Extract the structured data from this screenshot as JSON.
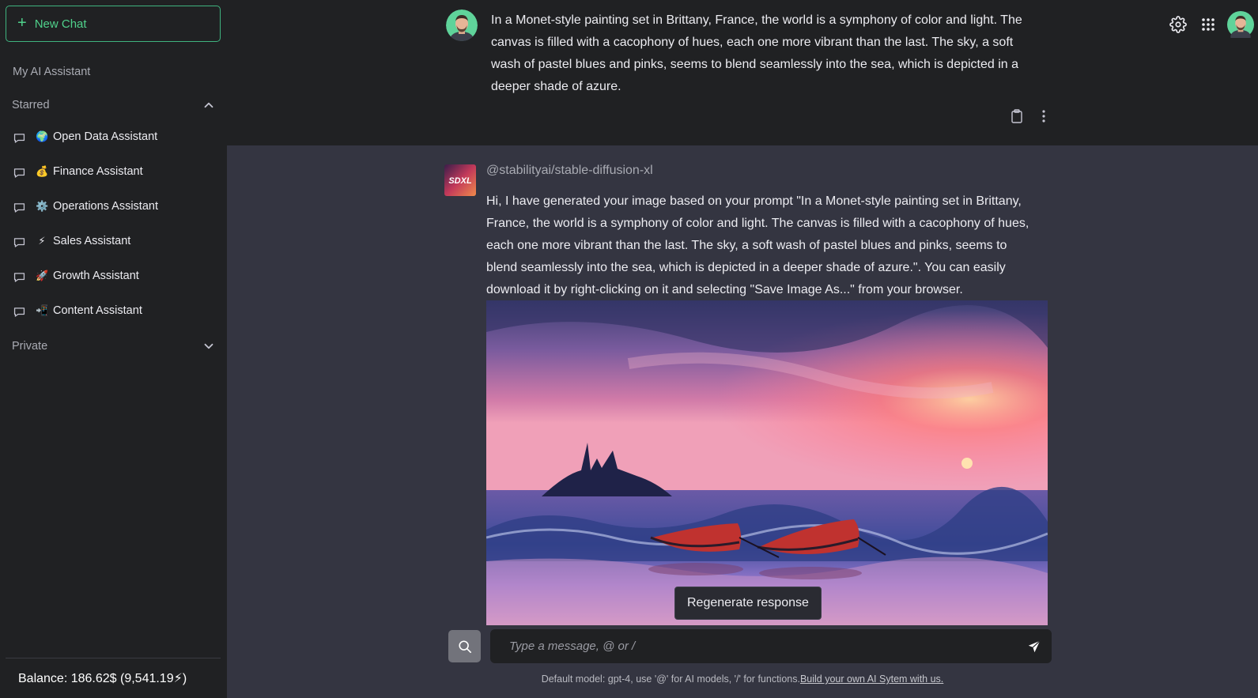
{
  "sidebar": {
    "new_chat_label": "New Chat",
    "workspace_title": "My AI Assistant",
    "starred_label": "Starred",
    "private_label": "Private",
    "items": [
      {
        "emoji": "🌍",
        "label": "Open Data Assistant"
      },
      {
        "emoji": "💰",
        "label": "Finance Assistant"
      },
      {
        "emoji": "⚙️",
        "label": "Operations Assistant"
      },
      {
        "emoji": "⚡",
        "label": "Sales Assistant"
      },
      {
        "emoji": "🚀",
        "label": "Growth Assistant"
      },
      {
        "emoji": "📲",
        "label": "Content Assistant"
      }
    ],
    "balance": "Balance: 186.62$ (9,541.19⚡)"
  },
  "conversation": {
    "user_message": "In a Monet-style painting set in Brittany, France, the world is a symphony of color and light. The canvas is filled with a cacophony of hues, each one more vibrant than the last. The sky, a soft wash of pastel blues and pinks, seems to blend seamlessly into the sea, which is depicted in a deeper shade of azure.",
    "assistant_model": "@stabilityai/stable-diffusion-xl",
    "assistant_avatar_text": "SDXL",
    "assistant_message": "Hi, I have generated your image based on your prompt \"In a Monet-style painting set in Brittany, France, the world is a symphony of color and light. The canvas is filled with a cacophony of hues, each one more vibrant than the last. The sky, a soft wash of pastel blues and pinks, seems to blend seamlessly into the sea, which is depicted in a deeper shade of azure.\". You can easily download it by right-clicking on it and selecting \"Save Image As...\" from your browser."
  },
  "composer": {
    "regenerate_label": "Regenerate response",
    "placeholder": "Type a message, @ or /",
    "footer_text": "Default model: gpt-4, use '@' for AI models, '/' for functions.",
    "footer_link": "Build your own AI Sytem with us."
  },
  "colors": {
    "accent": "#3fb37f",
    "sidebar_bg": "#202123",
    "main_bg": "#343541"
  }
}
